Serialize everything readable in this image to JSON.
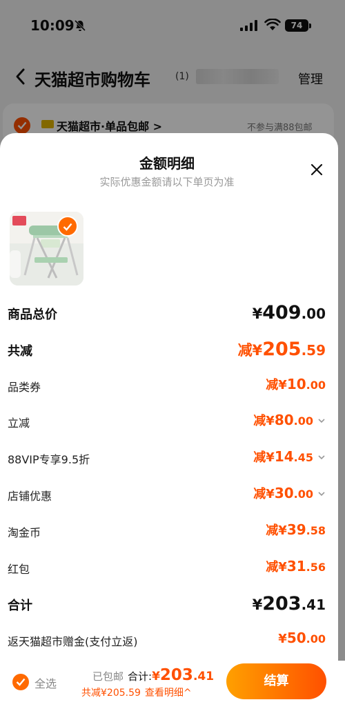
{
  "status_bar": {
    "time": "10:09",
    "battery": "74"
  },
  "nav": {
    "title": "天猫超市购物车",
    "count": "(1)",
    "manage": "管理"
  },
  "store": {
    "name": "天猫超市·单品包邮 >",
    "note": "不参与满88包邮"
  },
  "sheet": {
    "title": "金额明细",
    "subtitle": "实际优惠金额请以下单页为准",
    "rows": [
      {
        "label": "商品总价",
        "prefix": "¥",
        "int": "409",
        "dec": ".00"
      },
      {
        "label": "共减",
        "prefix": "减¥",
        "int": "205",
        "dec": ".59"
      },
      {
        "label": "品类券",
        "prefix": "减¥",
        "int": "10",
        "dec": ".00"
      },
      {
        "label": "立减",
        "prefix": "减¥",
        "int": "80",
        "dec": ".00"
      },
      {
        "label": "88VIP专享9.5折",
        "prefix": "减¥",
        "int": "14",
        "dec": ".45"
      },
      {
        "label": "店铺优惠",
        "prefix": "减¥",
        "int": "30",
        "dec": ".00"
      },
      {
        "label": "淘金币",
        "prefix": "减¥",
        "int": "39",
        "dec": ".58"
      },
      {
        "label": "红包",
        "prefix": "减¥",
        "int": "31",
        "dec": ".56"
      },
      {
        "label": "合计",
        "prefix": "¥",
        "int": "203",
        "dec": ".41"
      },
      {
        "label": "返天猫超市赠金(支付立返)",
        "prefix": "¥",
        "int": "50",
        "dec": ".00"
      }
    ]
  },
  "bottom_bar": {
    "select_all": "全选",
    "free_shipping": "已包邮",
    "total_label": "合计:",
    "total_prefix": "¥",
    "total_int": "203",
    "total_dec": ".41",
    "discount_text": "共减¥205.59",
    "detail_link": "查看明细^",
    "checkout": "结算"
  },
  "colors": {
    "accent": "#ff5000",
    "gradient_start": "#ffa000"
  },
  "icons": [
    "mute-icon",
    "signal-icon",
    "wifi-icon",
    "back-icon",
    "check-icon",
    "close-icon",
    "chevron-down-icon"
  ]
}
